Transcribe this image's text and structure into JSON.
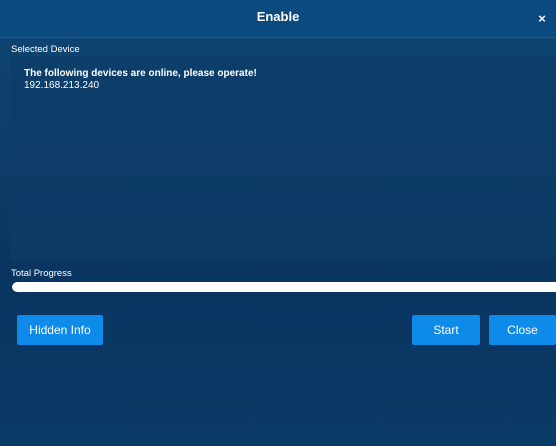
{
  "dialog": {
    "title": "Enable",
    "close_glyph": "×",
    "close_icon": "close-icon"
  },
  "selected_device": {
    "label": "Selected Device",
    "heading": "The following devices are online, please operate!",
    "ip": "192.168.213.240"
  },
  "progress": {
    "label": "Total Progress",
    "value": 100
  },
  "buttons": {
    "hidden_info": "Hidden Info",
    "start": "Start",
    "close": "Close"
  },
  "colors": {
    "accent": "#0e8ae8",
    "background": "#0c3a63"
  }
}
